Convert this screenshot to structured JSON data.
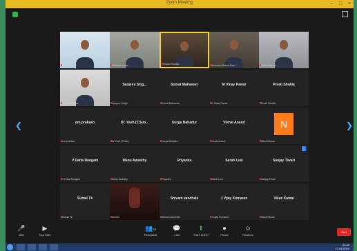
{
  "window": {
    "title": "Zoom Meeting",
    "accent_color": "#e8b923",
    "background_color": "#1a1a1a"
  },
  "participants": [
    {
      "display_name": "",
      "label": "Ganesh Bhat"
    },
    {
      "display_name": "",
      "label": "Akhilesh Yadav"
    },
    {
      "display_name": "",
      "label": "Shyam Sundar"
    },
    {
      "display_name": "",
      "label": "Ravindra Meena Patel"
    },
    {
      "display_name": "",
      "label": "Neha Sharma"
    },
    {
      "display_name": "",
      "label": "Deepak Kumar"
    },
    {
      "display_name": "Sanjeev Sing...",
      "label": "Sanjeev Singh"
    },
    {
      "display_name": "Sumat Mahaveer",
      "label": "Sumat Mahaveer"
    },
    {
      "display_name": "M Vinay Pawar",
      "label": "M Vinay Pawar"
    },
    {
      "display_name": "Preeti Shukla",
      "label": "Preeti Shukla"
    },
    {
      "display_name": "om prakash",
      "label": "om prakash"
    },
    {
      "display_name": "Dr. Yash (T.Sub...",
      "label": "Dr Yash (T.Sub)"
    },
    {
      "display_name": "Durga Bahadur",
      "label": "Durga Bahadur"
    },
    {
      "display_name": "Vishal Anand",
      "label": "Vishal Anand"
    },
    {
      "display_name": "N",
      "label": "Nikhil Mohan"
    },
    {
      "display_name": "V Datta Rangam",
      "label": "V Datta Rangam"
    },
    {
      "display_name": "Manu Awasthy",
      "label": "Manu Awasthy"
    },
    {
      "display_name": "Priyanka",
      "label": "Priyanka"
    },
    {
      "display_name": "Sarah Lusi",
      "label": "Sarah Lusi"
    },
    {
      "display_name": "Sanjay Tiwari",
      "label": "Sanjay Tiwari"
    },
    {
      "display_name": "Suhail Tk",
      "label": "Suhail Tk"
    },
    {
      "display_name": "",
      "label": "Anshul"
    },
    {
      "display_name": "Shivam kanchals",
      "label": "Shivam kanchals"
    },
    {
      "display_name": "J Vijay Kumaran",
      "label": "J Vijay Kumaran"
    },
    {
      "display_name": "Vikas Kamal",
      "label": "Vikas Kamal"
    }
  ],
  "toolbar": {
    "mute": {
      "label": "Mute",
      "icon": "microphone-icon"
    },
    "stop_video": {
      "label": "Stop Video",
      "icon": "video-camera-icon"
    },
    "participants": {
      "label": "Participants",
      "count": "83",
      "icon": "participants-icon"
    },
    "chat": {
      "label": "Chat",
      "icon": "chat-icon"
    },
    "share_screen": {
      "label": "Share Screen",
      "icon": "share-screen-icon"
    },
    "record": {
      "label": "Record",
      "icon": "record-icon"
    },
    "reactions": {
      "label": "Reactions",
      "icon": "reactions-icon"
    },
    "end": {
      "label": "End",
      "color": "#e02828"
    }
  },
  "taskbar": {
    "time": "09:52",
    "date": "17-08-2020"
  }
}
